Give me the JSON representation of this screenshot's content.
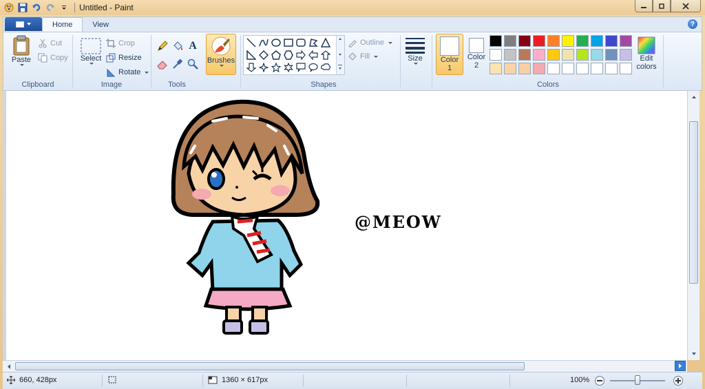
{
  "window": {
    "title": "Untitled - Paint"
  },
  "tabs": [
    {
      "label": "Home"
    },
    {
      "label": "View"
    }
  ],
  "clipboard": {
    "paste": "Paste",
    "cut": "Cut",
    "copy": "Copy",
    "group": "Clipboard"
  },
  "image": {
    "select": "Select",
    "crop": "Crop",
    "resize": "Resize",
    "rotate": "Rotate",
    "group": "Image"
  },
  "tools": {
    "group": "Tools"
  },
  "brushes": {
    "label": "Brushes"
  },
  "shapes": {
    "outline": "Outline",
    "fill": "Fill",
    "group": "Shapes"
  },
  "size": {
    "label": "Size"
  },
  "colors": {
    "color1_line1": "Color",
    "color1_line2": "1",
    "color2_line1": "Color",
    "color2_line2": "2",
    "edit_line1": "Edit",
    "edit_line2": "colors",
    "group": "Colors",
    "palette": [
      "#000000",
      "#7f7f7f",
      "#880015",
      "#ed1c24",
      "#ff7f27",
      "#fff200",
      "#22b14c",
      "#00a2e8",
      "#3f48cc",
      "#a349a4",
      "#ffffff",
      "#c3c3c3",
      "#b97a57",
      "#ffaec9",
      "#ffc90e",
      "#efe4b0",
      "#b5e61d",
      "#99d9ea",
      "#7092be",
      "#c8bfe7",
      "#fbe3b3",
      "#f9d3a8",
      "#f8cfa5",
      "#f5a9b0",
      "#ffffff",
      "#ffffff",
      "#ffffff",
      "#ffffff",
      "#ffffff",
      "#ffffff"
    ]
  },
  "canvas": {
    "watermark_text": "@MEOW"
  },
  "status": {
    "cursor": "660, 428px",
    "size": "1360 × 617px",
    "zoom": "100%"
  }
}
